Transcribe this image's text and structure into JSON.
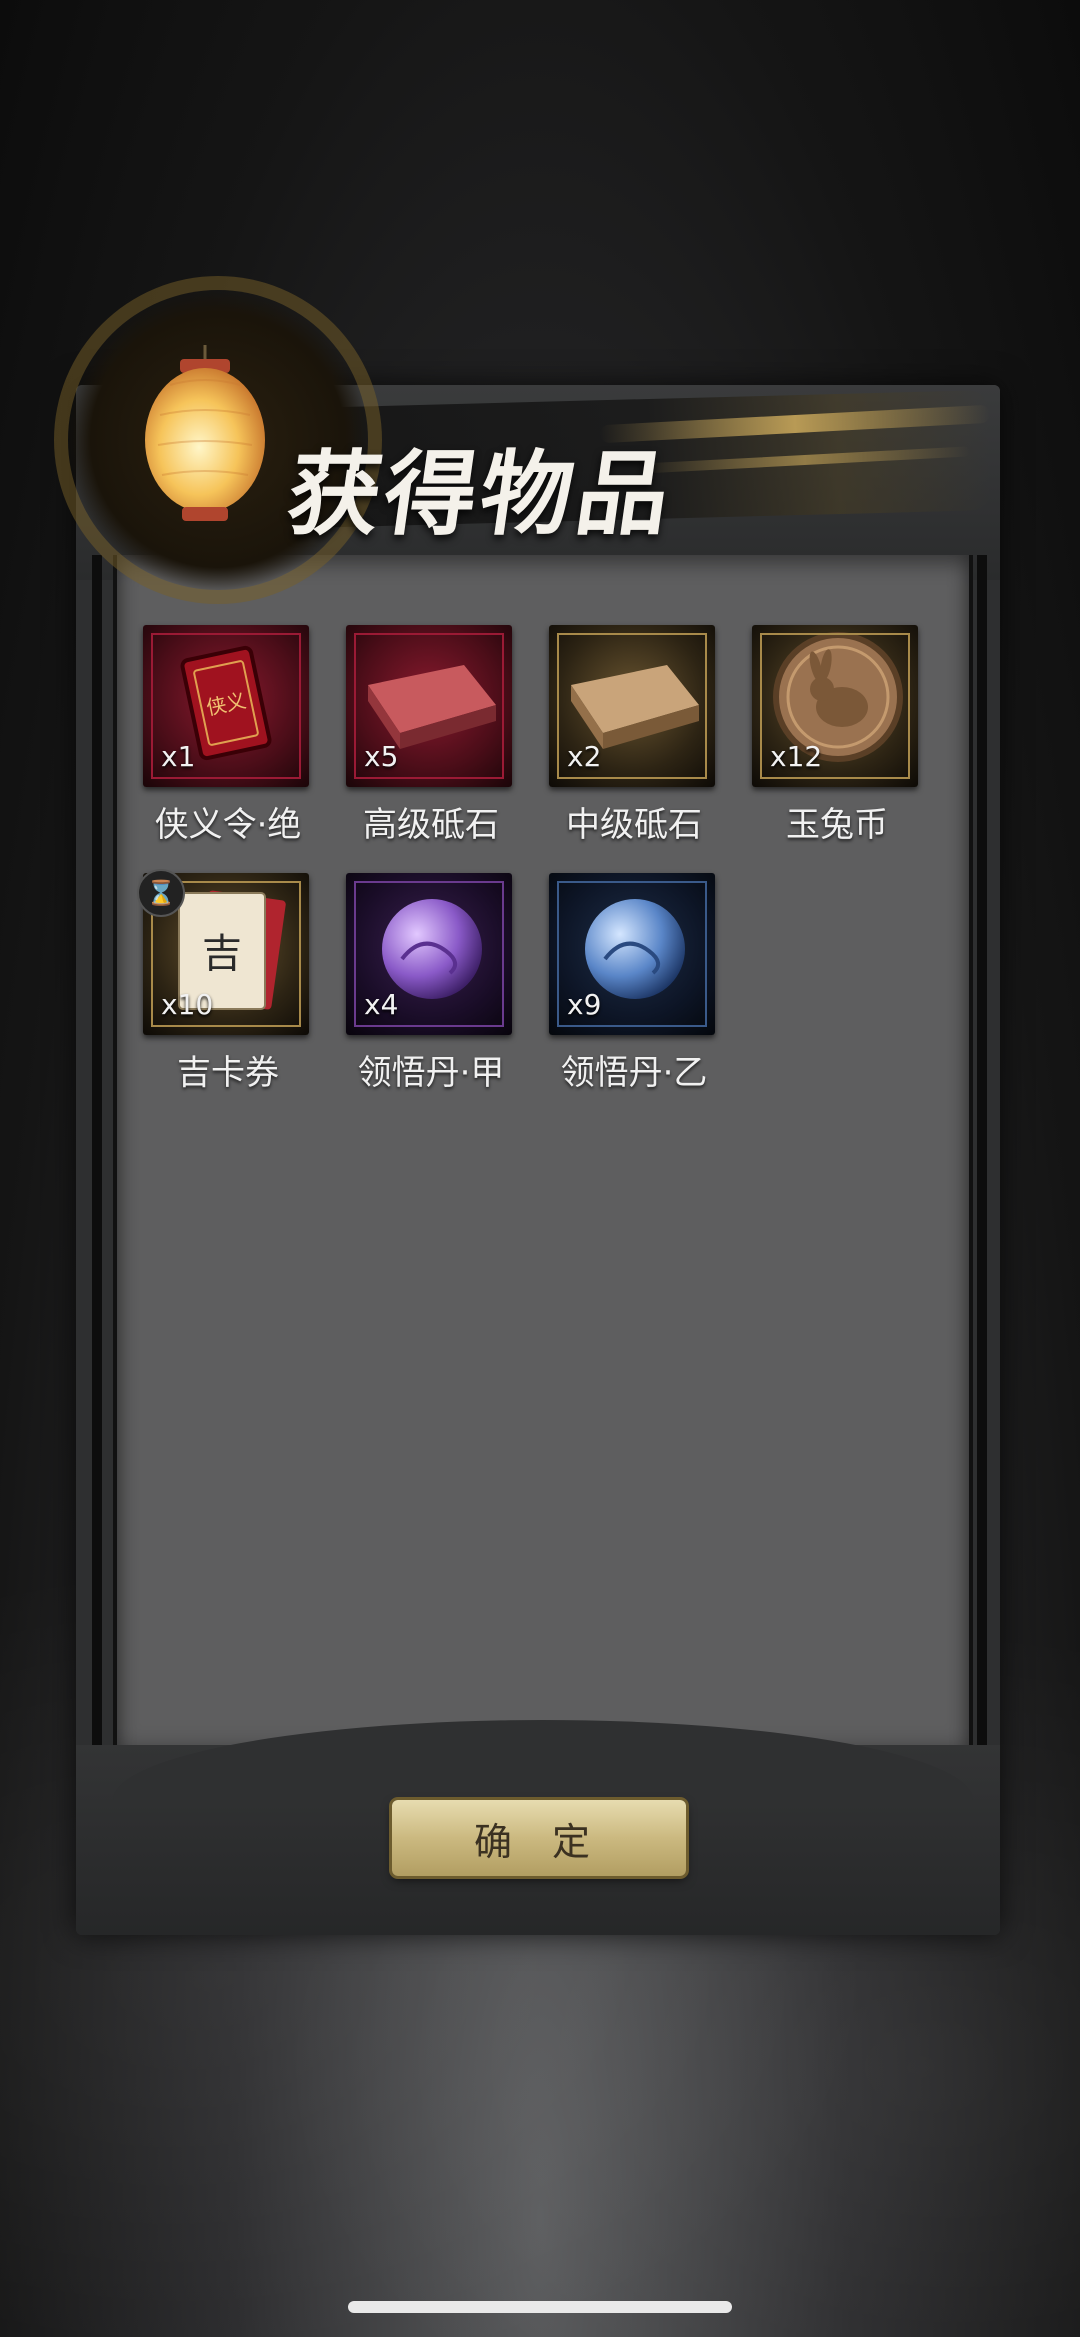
{
  "dialog": {
    "title": "获得物品",
    "confirm_label": "确 定"
  },
  "items": [
    {
      "name": "侠义令·绝",
      "qty": "x1",
      "icon": "xiayi-token-icon",
      "rarity": "red",
      "rarity_color": "#9b1a35"
    },
    {
      "name": "高级砥石",
      "qty": "x5",
      "icon": "whetstone-high-icon",
      "rarity": "red",
      "rarity_color": "#9b1a35"
    },
    {
      "name": "中级砥石",
      "qty": "x2",
      "icon": "whetstone-mid-icon",
      "rarity": "gold",
      "rarity_color": "#a88a4a"
    },
    {
      "name": "玉兔币",
      "qty": "x12",
      "icon": "rabbit-coin-icon",
      "rarity": "gold",
      "rarity_color": "#a88a4a"
    },
    {
      "name": "吉卡券",
      "qty": "x10",
      "icon": "lucky-card-icon",
      "rarity": "gold",
      "rarity_color": "#a88a4a",
      "timed": true
    },
    {
      "name": "领悟丹·甲",
      "qty": "x4",
      "icon": "purple-pill-icon",
      "rarity": "purple",
      "rarity_color": "#6a3a8e"
    },
    {
      "name": "领悟丹·乙",
      "qty": "x9",
      "icon": "blue-pill-icon",
      "rarity": "blue",
      "rarity_color": "#3a5a8a"
    }
  ]
}
